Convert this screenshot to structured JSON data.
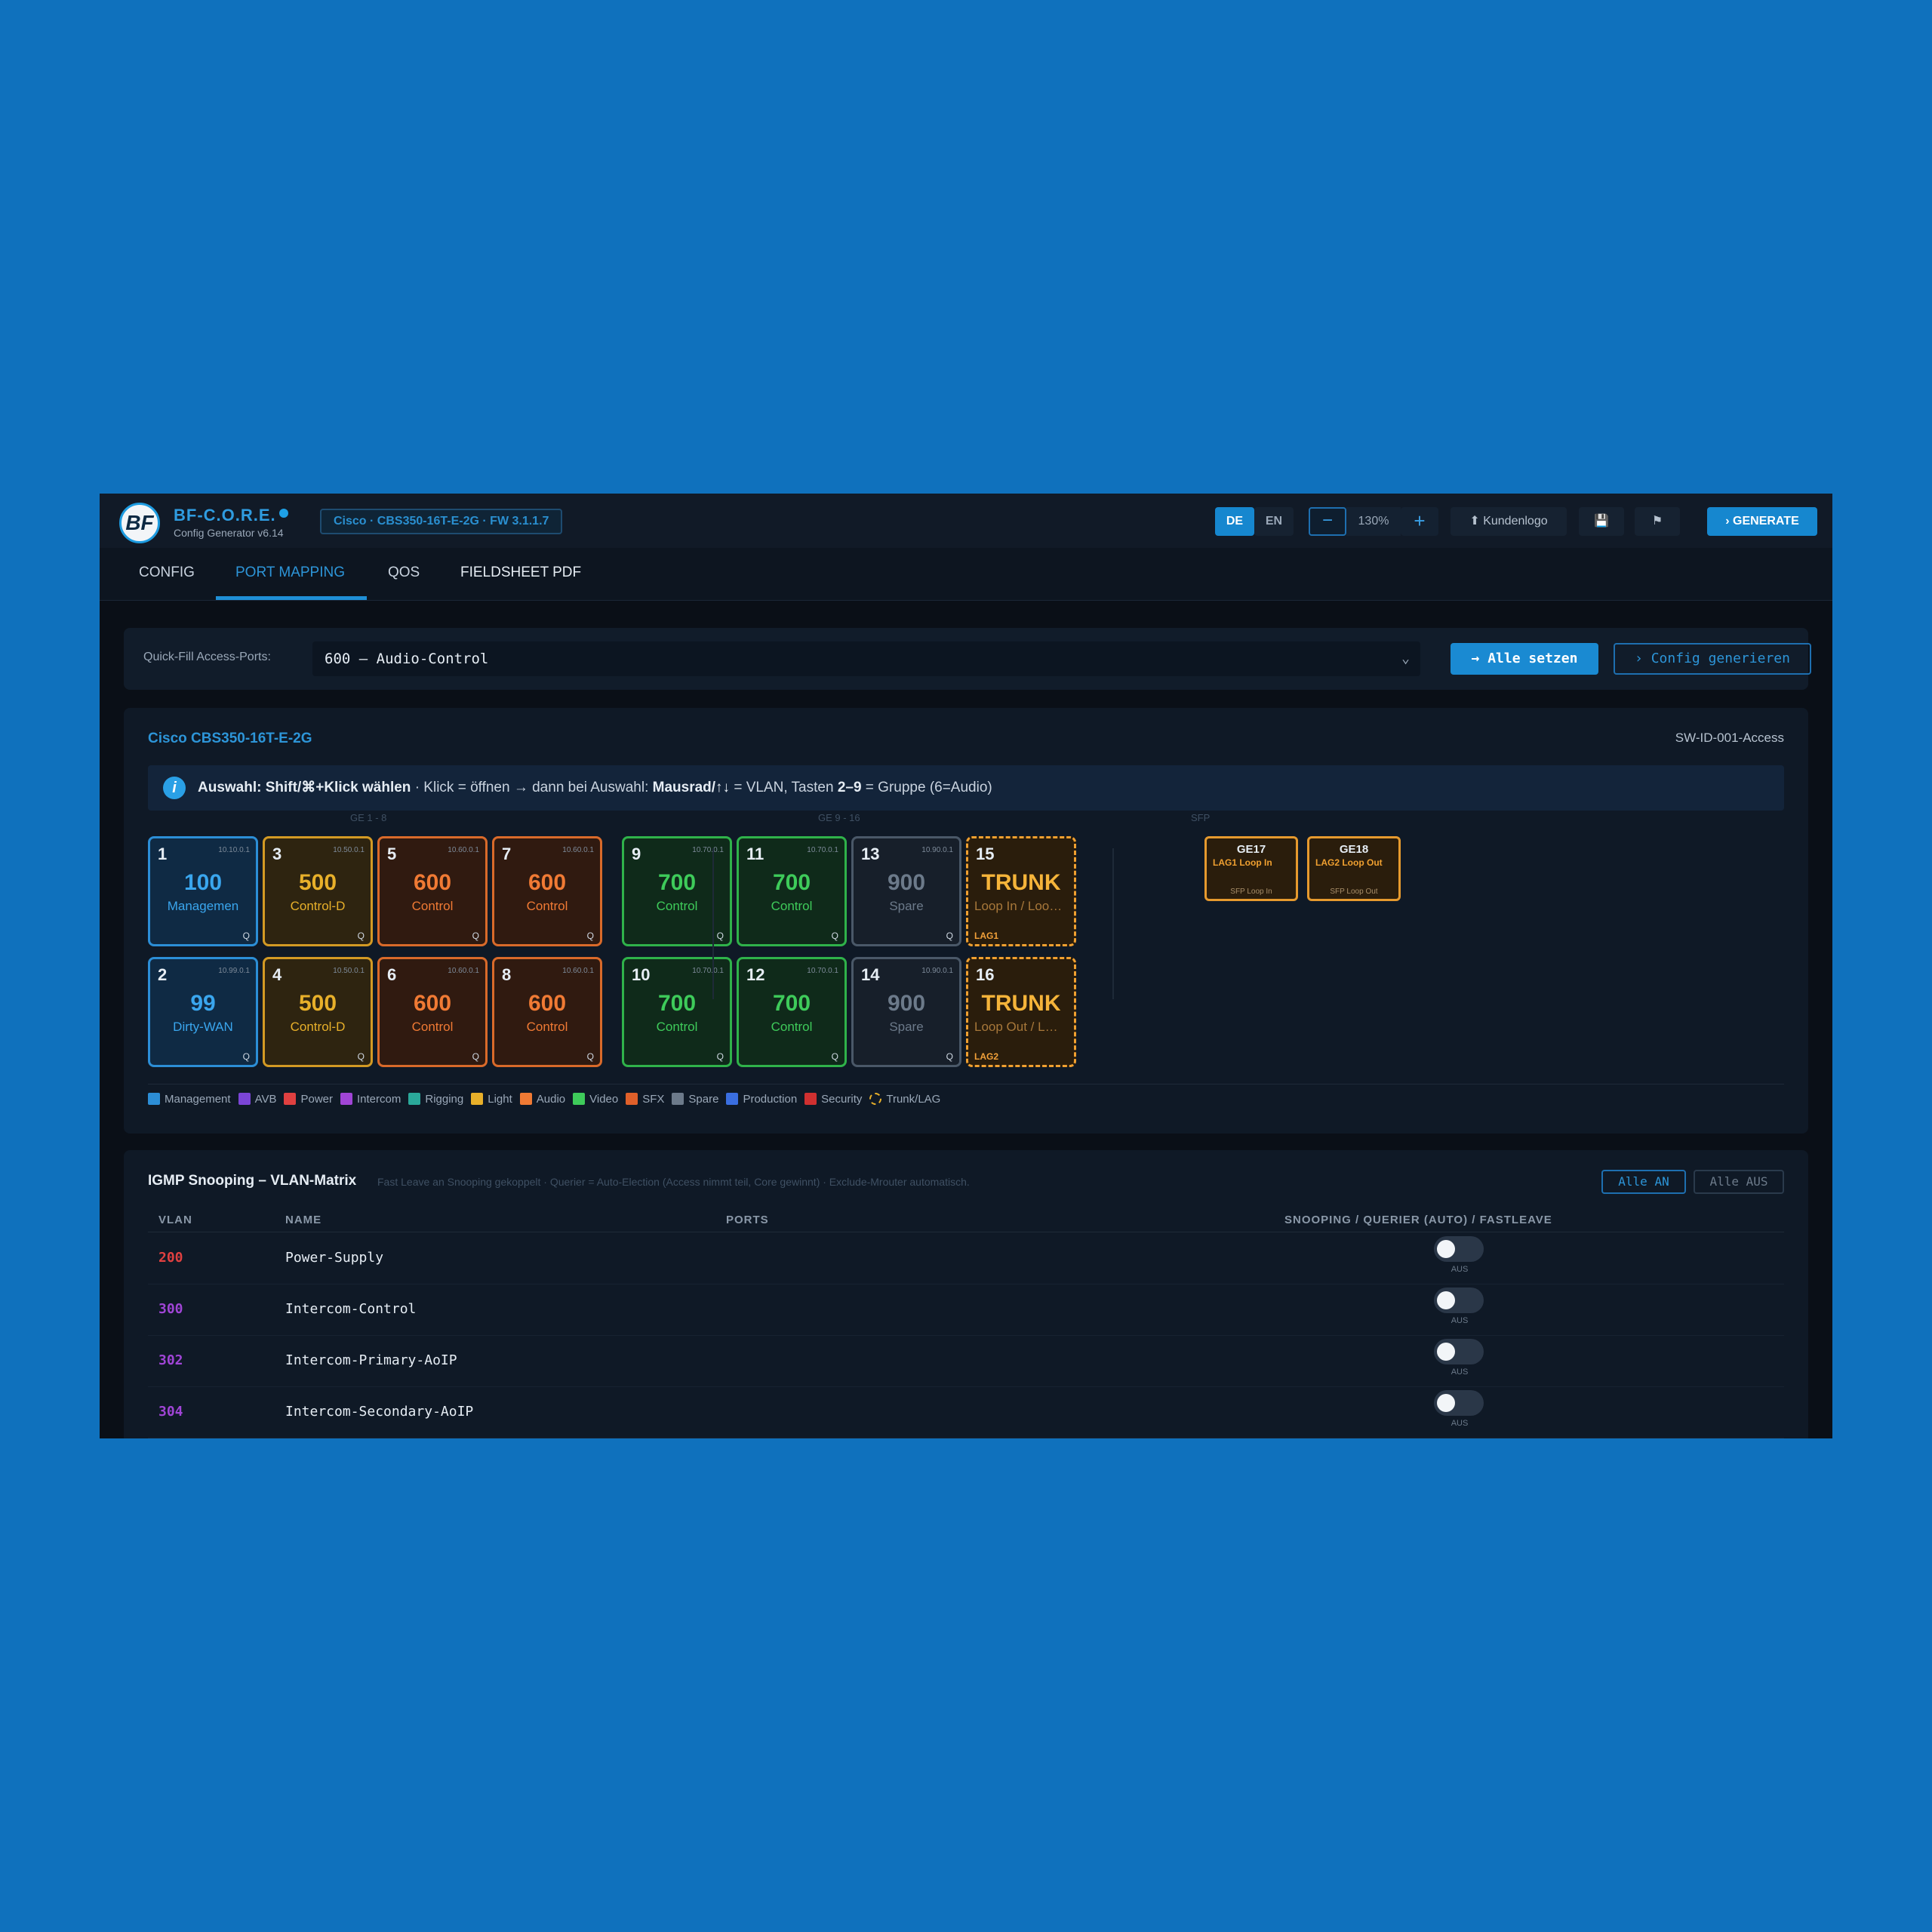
{
  "header": {
    "brand_title": "BF-C.O.R.E.",
    "brand_sub": "Config Generator v6.14",
    "logo_text": "BF",
    "device": "Cisco · CBS350-16T-E-2G · FW 3.1.1.7",
    "lang_de": "DE",
    "lang_en": "EN",
    "zoom_minus": "−",
    "zoom": "130%",
    "zoom_plus": "+",
    "customer_logo": "⬆ Kundenlogo",
    "save_icon": "💾",
    "flag_icon": "⚑",
    "generate": "› GENERATE"
  },
  "tabs": [
    "CONFIG",
    "PORT MAPPING",
    "QOS",
    "FIELDSHEET PDF"
  ],
  "quickfill": {
    "label": "Quick-Fill Access-Ports:",
    "value": "600 – Audio-Control",
    "chevron": "⌄",
    "all_set": "→ Alle setzen",
    "config": "› Config generieren"
  },
  "switch": {
    "title": "Cisco CBS350-16T-E-2G",
    "id": "SW-ID-001-Access",
    "hint_icon": "i",
    "hint_b1": "Auswahl: Shift/⌘+Klick wählen",
    "hint_t1": " · Klick = öffnen → dann bei Auswahl: ",
    "hint_b2": "Mausrad/↑↓",
    "hint_t2": " = VLAN, Tasten ",
    "hint_b3": "2–9",
    "hint_t3": " = Gruppe (6=Audio)",
    "group_1_8": "GE 1 - 8",
    "group_9_16": "GE 9 - 16",
    "group_sfp": "SFP",
    "ports": [
      {
        "num": "1",
        "ip": "10.10.0.1",
        "vlan": "100",
        "name": "Managemen",
        "color": "blue",
        "q": "Q"
      },
      {
        "num": "3",
        "ip": "10.50.0.1",
        "vlan": "500",
        "name": "Control-D",
        "color": "yellow",
        "q": "Q"
      },
      {
        "num": "5",
        "ip": "10.60.0.1",
        "vlan": "600",
        "name": "Control",
        "color": "orange",
        "q": "Q"
      },
      {
        "num": "7",
        "ip": "10.60.0.1",
        "vlan": "600",
        "name": "Control",
        "color": "orange",
        "q": "Q"
      },
      {
        "num": "9",
        "ip": "10.70.0.1",
        "vlan": "700",
        "name": "Control",
        "color": "green",
        "q": "Q"
      },
      {
        "num": "11",
        "ip": "10.70.0.1",
        "vlan": "700",
        "name": "Control",
        "color": "green",
        "q": "Q"
      },
      {
        "num": "13",
        "ip": "10.90.0.1",
        "vlan": "900",
        "name": "Spare",
        "color": "gray",
        "q": "Q"
      },
      {
        "num": "15",
        "ip": "",
        "vlan": "TRUNK",
        "name": "Loop In / Loo…",
        "color": "trunk",
        "lag": "LAG1"
      },
      {
        "num": "2",
        "ip": "10.99.0.1",
        "vlan": "99",
        "name": "Dirty-WAN",
        "color": "blue",
        "q": "Q"
      },
      {
        "num": "4",
        "ip": "10.50.0.1",
        "vlan": "500",
        "name": "Control-D",
        "color": "yellow",
        "q": "Q"
      },
      {
        "num": "6",
        "ip": "10.60.0.1",
        "vlan": "600",
        "name": "Control",
        "color": "orange",
        "q": "Q"
      },
      {
        "num": "8",
        "ip": "10.60.0.1",
        "vlan": "600",
        "name": "Control",
        "color": "orange",
        "q": "Q"
      },
      {
        "num": "10",
        "ip": "10.70.0.1",
        "vlan": "700",
        "name": "Control",
        "color": "green",
        "q": "Q"
      },
      {
        "num": "12",
        "ip": "10.70.0.1",
        "vlan": "700",
        "name": "Control",
        "color": "green",
        "q": "Q"
      },
      {
        "num": "14",
        "ip": "10.90.0.1",
        "vlan": "900",
        "name": "Spare",
        "color": "gray",
        "q": "Q"
      },
      {
        "num": "16",
        "ip": "",
        "vlan": "TRUNK",
        "name": "Loop Out / L…",
        "color": "trunk",
        "lag": "LAG2"
      }
    ],
    "sfp": [
      {
        "title": "GE17",
        "name": "LAG1 Loop In",
        "sub": "SFP Loop In"
      },
      {
        "title": "GE18",
        "name": "LAG2 Loop Out",
        "sub": "SFP Loop Out"
      }
    ],
    "legend": [
      {
        "label": "Management",
        "color": "#2c8ed6"
      },
      {
        "label": "AVB",
        "color": "#7b45d6"
      },
      {
        "label": "Power",
        "color": "#e04040"
      },
      {
        "label": "Intercom",
        "color": "#a045d6"
      },
      {
        "label": "Rigging",
        "color": "#2aa89a"
      },
      {
        "label": "Light",
        "color": "#e8b02a"
      },
      {
        "label": "Audio",
        "color": "#f07a34"
      },
      {
        "label": "Video",
        "color": "#3ecb5a"
      },
      {
        "label": "SFX",
        "color": "#e0602a"
      },
      {
        "label": "Spare",
        "color": "#6c7a8a"
      },
      {
        "label": "Production",
        "color": "#3a6ee0"
      },
      {
        "label": "Security",
        "color": "#d03030"
      },
      {
        "label": "Trunk/LAG",
        "color": "dashed"
      }
    ]
  },
  "igmp": {
    "title": "IGMP Snooping – VLAN-Matrix",
    "subtitle": "Fast Leave an Snooping gekoppelt · Querier = Auto-Election (Access nimmt teil, Core gewinnt) · Exclude-Mrouter automatisch.",
    "all_on": "Alle AN",
    "all_off": "Alle AUS",
    "col_vlan": "VLAN",
    "col_name": "NAME",
    "col_ports": "PORTS",
    "col_snoop": "SNOOPING / QUERIER (AUTO) / FASTLEAVE",
    "rows": [
      {
        "vlan": "200",
        "name": "Power-Supply",
        "color": "#e04040",
        "state": "AUS"
      },
      {
        "vlan": "300",
        "name": "Intercom-Control",
        "color": "#a045d6",
        "state": "AUS"
      },
      {
        "vlan": "302",
        "name": "Intercom-Primary-AoIP",
        "color": "#a045d6",
        "state": "AUS"
      },
      {
        "vlan": "304",
        "name": "Intercom-Secondary-AoIP",
        "color": "#a045d6",
        "state": "AUS"
      }
    ]
  }
}
